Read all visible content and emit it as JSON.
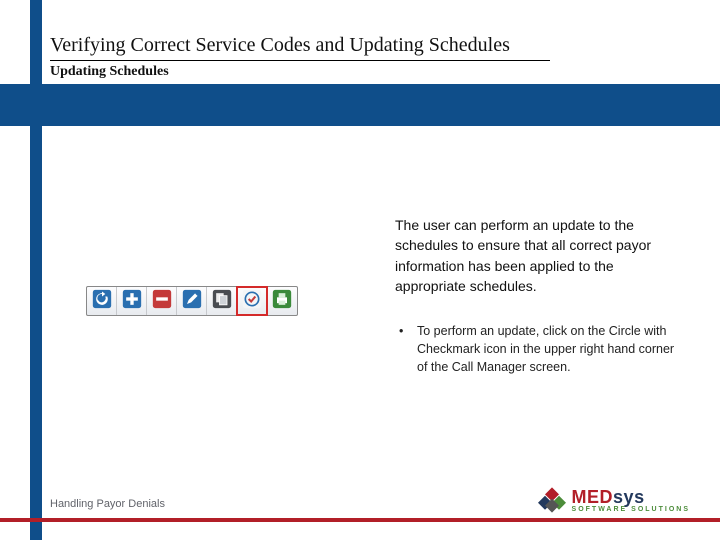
{
  "header": {
    "title": "Verifying Correct Service Codes and Updating Schedules",
    "subtitle": "Updating Schedules"
  },
  "body": {
    "paragraph": "The user can perform an update to the schedules to ensure that all correct payor information has been applied to the appropriate schedules.",
    "bullet": "To perform an update, click on the Circle with Checkmark icon in the upper right hand corner of the Call Manager screen."
  },
  "toolbar": {
    "icons": [
      "refresh-icon",
      "add-icon",
      "delete-icon",
      "edit-icon",
      "copy-icon",
      "circle-checkmark-icon",
      "print-icon"
    ],
    "highlighted": "circle-checkmark-icon"
  },
  "footer": {
    "text": "Handling Payor Denials"
  },
  "logo": {
    "brand_part1": "MED",
    "brand_part2": "sys",
    "tagline": "SOFTWARE SOLUTIONS"
  },
  "colors": {
    "brand_blue": "#0f4e8a",
    "brand_red": "#b21f28",
    "brand_green": "#4c8c3a"
  }
}
